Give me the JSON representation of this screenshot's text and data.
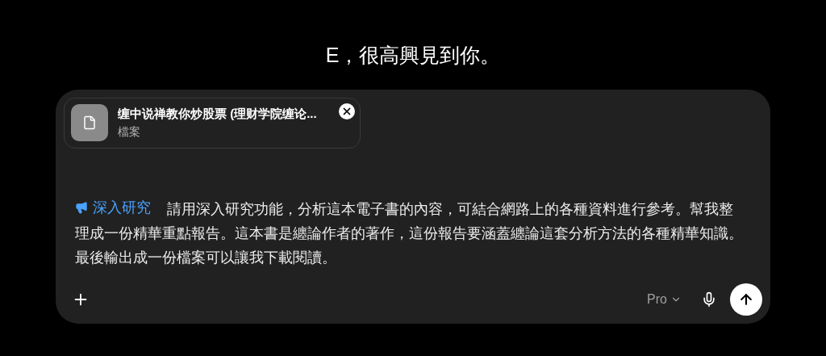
{
  "greeting": "E，很高興見到你。",
  "composer": {
    "attachment": {
      "name": "缠中说禅教你炒股票 (理财学院缠论...",
      "type": "檔案"
    },
    "tool_tag": "深入研究",
    "prompt": "請用深入研究功能，分析這本電子書的內容，可結合網路上的各種資料進行參考。幫我整理成一份精華重點報告。這本書是纏論作者的著作，這份報告要涵蓋纏論這套分析方法的各種精華知識。最後輸出成一份檔案可以讓我下載閱讀。",
    "model": "Pro"
  }
}
